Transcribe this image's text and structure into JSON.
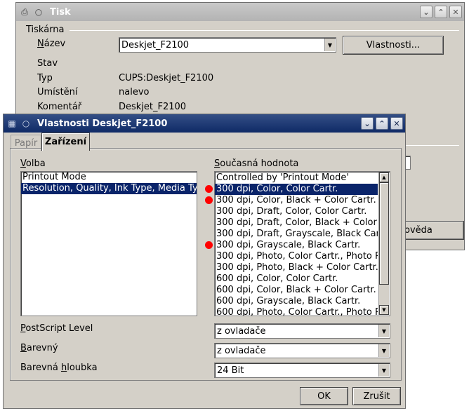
{
  "print_dialog": {
    "title": "Tisk",
    "group_label": "Tiskárna",
    "name_label": "Název",
    "name_label_accel": "N",
    "name_label_rest": "ázev",
    "printer_value": "Deskjet_F2100",
    "properties_button": "Vlastnosti...",
    "status_label": "Stav",
    "status_value": "",
    "type_label": "Typ",
    "type_value": "CUPS:Deskjet_F2100",
    "location_label": "Umístění",
    "location_value": "nalevo",
    "comment_label": "Komentář",
    "comment_value": "Deskjet_F2100",
    "help_button": "ověda"
  },
  "properties_dialog": {
    "title": "Vlastnosti Deskjet_F2100",
    "tabs": [
      {
        "label": "Papír",
        "active": false
      },
      {
        "label": "Zařízení",
        "active": true
      }
    ],
    "option_label_accel": "V",
    "option_label_rest": "olba",
    "options": [
      {
        "label": "Printout Mode",
        "selected": false
      },
      {
        "label": "Resolution, Quality, Ink Type, Media Typ",
        "selected": true
      }
    ],
    "current_value_label_accel": "S",
    "current_value_label_rest": "oučasná hodnota",
    "values": [
      {
        "label": "Controlled by 'Printout Mode'",
        "selected": false,
        "marked": false
      },
      {
        "label": "300 dpi, Color, Color Cartr.",
        "selected": true,
        "marked": true
      },
      {
        "label": "300 dpi, Color, Black + Color Cartr.",
        "selected": false,
        "marked": true
      },
      {
        "label": "300 dpi, Draft, Color, Color Cartr.",
        "selected": false,
        "marked": false
      },
      {
        "label": "300 dpi, Draft, Color, Black + Color C",
        "selected": false,
        "marked": false
      },
      {
        "label": "300 dpi, Draft, Grayscale, Black Cart",
        "selected": false,
        "marked": false
      },
      {
        "label": "300 dpi, Grayscale, Black Cartr.",
        "selected": false,
        "marked": true
      },
      {
        "label": "300 dpi, Photo, Color Cartr., Photo P",
        "selected": false,
        "marked": false
      },
      {
        "label": "300 dpi, Photo, Black + Color Cartr.,",
        "selected": false,
        "marked": false
      },
      {
        "label": "600 dpi, Color, Color Cartr.",
        "selected": false,
        "marked": false
      },
      {
        "label": "600 dpi, Color, Black + Color Cartr.",
        "selected": false,
        "marked": false
      },
      {
        "label": "600 dpi, Grayscale, Black Cartr.",
        "selected": false,
        "marked": false
      },
      {
        "label": "600 dpi, Photo, Color Cartr., Photo P",
        "selected": false,
        "marked": false
      }
    ],
    "postscript_label_accel": "P",
    "postscript_label_rest": "ostScript Level",
    "postscript_value": "z ovladače",
    "color_label_accel": "B",
    "color_label_rest": "arevný",
    "color_value": "z ovladače",
    "depth_label_pre": "Barevná ",
    "depth_label_accel": "h",
    "depth_label_rest": "loubka",
    "depth_value": "24 Bit",
    "ok_button": "OK",
    "cancel_button": "Zrušit"
  },
  "colors": {
    "selection": "#0a246a",
    "marker": "#ff0000",
    "active_title": "#0f2a66"
  }
}
